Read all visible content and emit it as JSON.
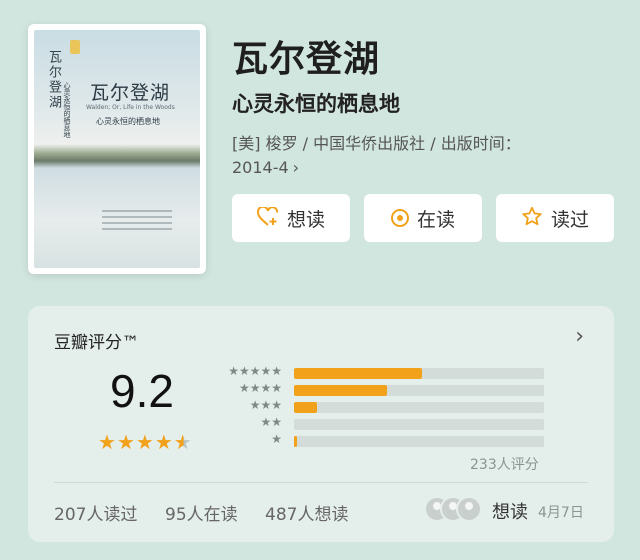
{
  "book": {
    "cover": {
      "title": "瓦尔登湖",
      "subtitle_en": "Walden; Or, Life in the Woods",
      "subtitle_cn": "心灵永恒的栖息地",
      "spine_title": "瓦尔登湖",
      "spine_sub": "心灵永恒的栖息地"
    },
    "title": "瓦尔登湖",
    "subtitle": "心灵永恒的栖息地",
    "meta_line1": "[美] 梭罗 / 中国华侨出版社 / 出版时间：",
    "meta_line2": "2014-4",
    "meta_chevron": "›"
  },
  "actions": {
    "want": {
      "label": "想读",
      "icon": "heart-plus-icon"
    },
    "reading": {
      "label": "在读",
      "icon": "target-icon"
    },
    "read": {
      "label": "读过",
      "icon": "star-outline-icon"
    }
  },
  "rating": {
    "title": "豆瓣评分™",
    "chevron": "›",
    "score": "9.2",
    "stars": 4.5,
    "distribution": [
      {
        "stars": "★★★★★",
        "fraction": 0.51
      },
      {
        "stars": "★★★★",
        "fraction": 0.37
      },
      {
        "stars": "★★★",
        "fraction": 0.09
      },
      {
        "stars": "★★",
        "fraction": 0.0
      },
      {
        "stars": "★",
        "fraction": 0.01
      }
    ],
    "count_label": "233人评分"
  },
  "stats": {
    "read": "207人读过",
    "reading": "95人在读",
    "want": "487人想读"
  },
  "friends": {
    "action_label": "想读",
    "date": "4月7日"
  },
  "colors": {
    "background": "#d2e6e0",
    "accent": "#f2a11b",
    "card": "#e4eeeb"
  }
}
